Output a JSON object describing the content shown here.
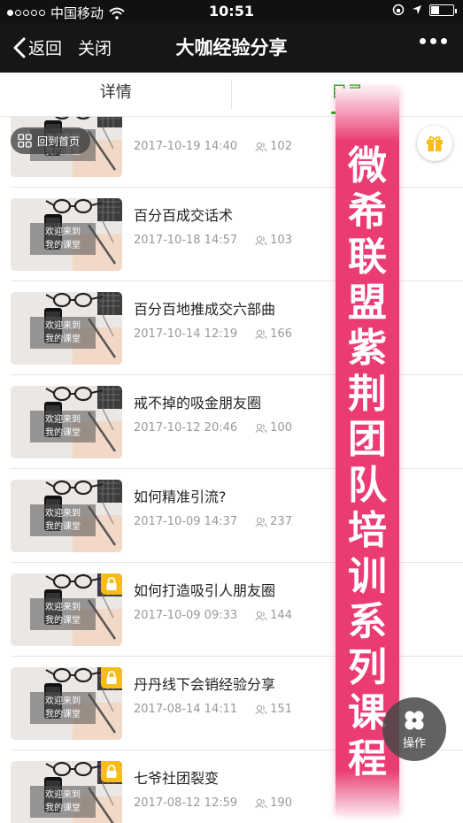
{
  "status_bar": {
    "carrier": "中国移动",
    "time": "10:51",
    "battery_level": 0.35,
    "signal_bars": 1
  },
  "nav": {
    "back_label": "返回",
    "close_label": "关闭",
    "title": "大咖经验分享"
  },
  "tabs": [
    {
      "label": "详情",
      "active": false
    },
    {
      "label": "目录",
      "active": true
    }
  ],
  "home_button_label": "回到首页",
  "thumb_caption_line1": "欢迎来到",
  "thumb_caption_line2": "我的课堂",
  "items": [
    {
      "title": "",
      "date": "2017-10-19 14:40",
      "views": "102",
      "locked": false
    },
    {
      "title": "百分百成交话术",
      "date": "2017-10-18 14:57",
      "views": "103",
      "locked": false
    },
    {
      "title": "百分百地推成交六部曲",
      "date": "2017-10-14 12:19",
      "views": "166",
      "locked": false
    },
    {
      "title": "戒不掉的吸金朋友圈",
      "date": "2017-10-12 20:46",
      "views": "100",
      "locked": false
    },
    {
      "title": "如何精准引流?",
      "date": "2017-10-09 14:37",
      "views": "237",
      "locked": false
    },
    {
      "title": "如何打造吸引人朋友圈",
      "date": "2017-10-09 09:33",
      "views": "144",
      "locked": true
    },
    {
      "title": "丹丹线下会销经验分享",
      "date": "2017-08-14 14:11",
      "views": "151",
      "locked": true
    },
    {
      "title": "七爷社团裂变",
      "date": "2017-08-12 12:59",
      "views": "190",
      "locked": true
    }
  ],
  "banner_text": "微希联盟紫荆团队培训系列课程",
  "ops_button_label": "操作",
  "colors": {
    "accent": "#1aad19",
    "banner": "#ea3c73",
    "lock": "#f6bd16"
  }
}
